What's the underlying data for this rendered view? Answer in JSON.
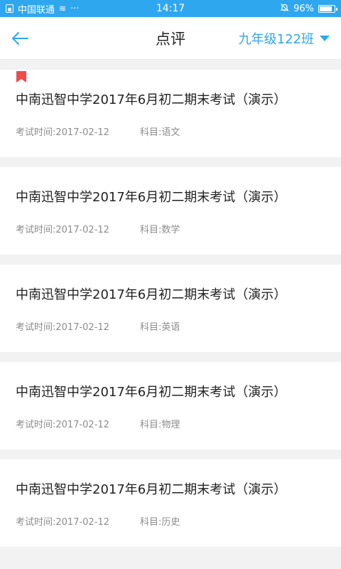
{
  "status_bar": {
    "carrier": "中国联通",
    "dots": "···",
    "time": "14:17",
    "battery": "96%"
  },
  "header": {
    "title": "点评",
    "class_selector": "九年级122班",
    "accent_color": "#2fa7ee"
  },
  "exams": [
    {
      "title": "中南迅智中学2017年6月初二期末考试（演示）",
      "date_label": "考试时间:2017-02-12",
      "subject_label": "科目:语文",
      "bookmarked": true
    },
    {
      "title": "中南迅智中学2017年6月初二期末考试（演示）",
      "date_label": "考试时间:2017-02-12",
      "subject_label": "科目:数学",
      "bookmarked": false
    },
    {
      "title": "中南迅智中学2017年6月初二期末考试（演示）",
      "date_label": "考试时间:2017-02-12",
      "subject_label": "科目:英语",
      "bookmarked": false
    },
    {
      "title": "中南迅智中学2017年6月初二期末考试（演示）",
      "date_label": "考试时间:2017-02-12",
      "subject_label": "科目:物理",
      "bookmarked": false
    },
    {
      "title": "中南迅智中学2017年6月初二期末考试（演示）",
      "date_label": "考试时间:2017-02-12",
      "subject_label": "科目:历史",
      "bookmarked": false
    }
  ]
}
